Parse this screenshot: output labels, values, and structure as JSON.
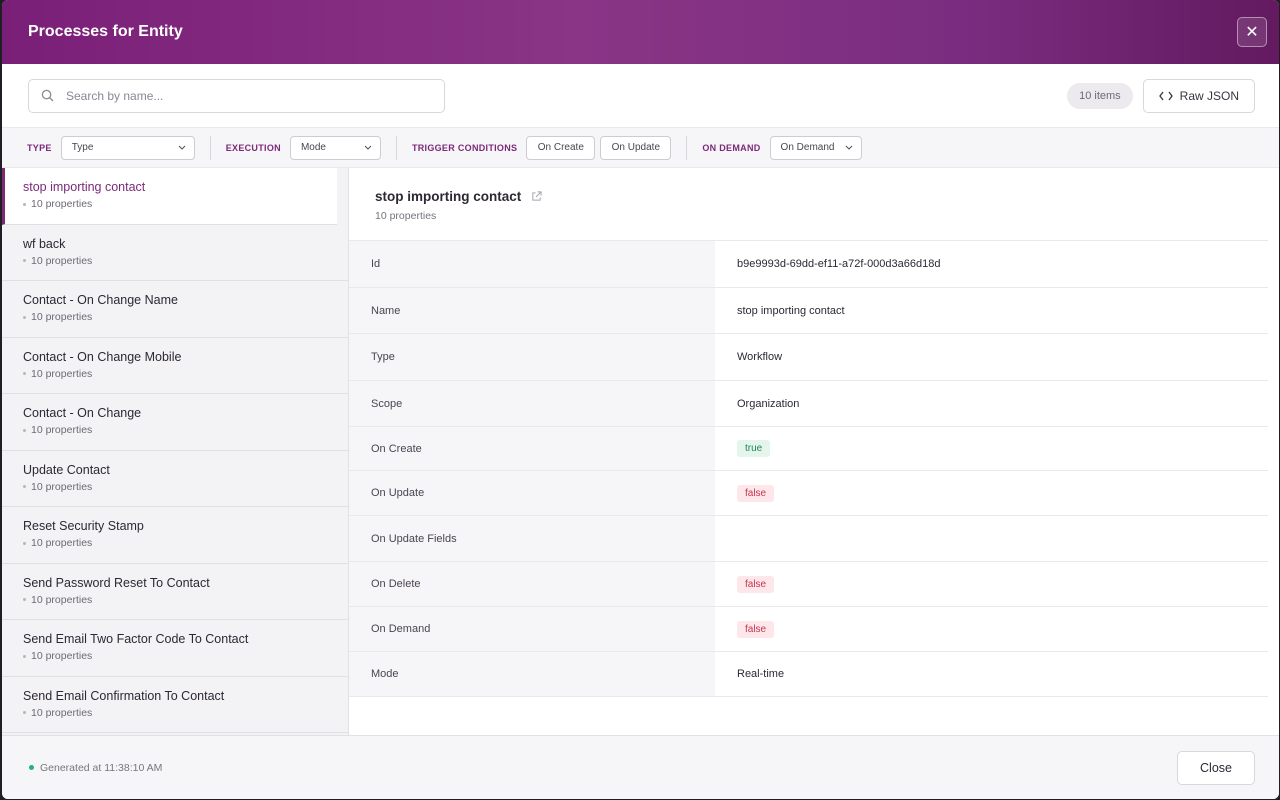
{
  "header": {
    "title": "Processes for Entity",
    "close_symbol": "✕"
  },
  "search": {
    "placeholder": "Search by name...",
    "value": ""
  },
  "toolbar": {
    "count_label": "10 items",
    "raw_json_label": "Raw JSON"
  },
  "filters": {
    "type_label": "TYPE",
    "type_value": "Type",
    "execution_label": "EXECUTION",
    "execution_value": "Mode",
    "trigger_label": "TRIGGER CONDITIONS",
    "on_create": "On Create",
    "on_update": "On Update",
    "demand_label": "ON DEMAND",
    "demand_value": "On Demand"
  },
  "list": [
    {
      "name": "stop importing contact",
      "sub": "10 properties"
    },
    {
      "name": "wf back",
      "sub": "10 properties"
    },
    {
      "name": "Contact - On Change Name",
      "sub": "10 properties"
    },
    {
      "name": "Contact - On Change Mobile",
      "sub": "10 properties"
    },
    {
      "name": "Contact - On Change",
      "sub": "10 properties"
    },
    {
      "name": "Update Contact",
      "sub": "10 properties"
    },
    {
      "name": "Reset Security Stamp",
      "sub": "10 properties"
    },
    {
      "name": "Send Password Reset To Contact",
      "sub": "10 properties"
    },
    {
      "name": "Send Email Two Factor Code To Contact",
      "sub": "10 properties"
    },
    {
      "name": "Send Email Confirmation To Contact",
      "sub": "10 properties"
    }
  ],
  "detail": {
    "title": "stop importing contact",
    "sub": "10 properties",
    "props": [
      {
        "key": "Id",
        "value": "b9e9993d-69dd-ef11-a72f-000d3a66d18d"
      },
      {
        "key": "Name",
        "value": "stop importing contact"
      },
      {
        "key": "Type",
        "value": "Workflow"
      },
      {
        "key": "Scope",
        "value": "Organization"
      },
      {
        "key": "On Create",
        "value": "true"
      },
      {
        "key": "On Update",
        "value": "false"
      },
      {
        "key": "On Update Fields",
        "value": ""
      },
      {
        "key": "On Delete",
        "value": "false"
      },
      {
        "key": "On Demand",
        "value": "false"
      },
      {
        "key": "Mode",
        "value": "Real-time"
      }
    ]
  },
  "footer": {
    "generated": "Generated at 11:38:10 AM",
    "close_label": "Close"
  },
  "colors": {
    "accent": "#7b2a78",
    "true_tag": "#23845a",
    "false_tag": "#c7354e",
    "status_dot": "#22b573"
  }
}
